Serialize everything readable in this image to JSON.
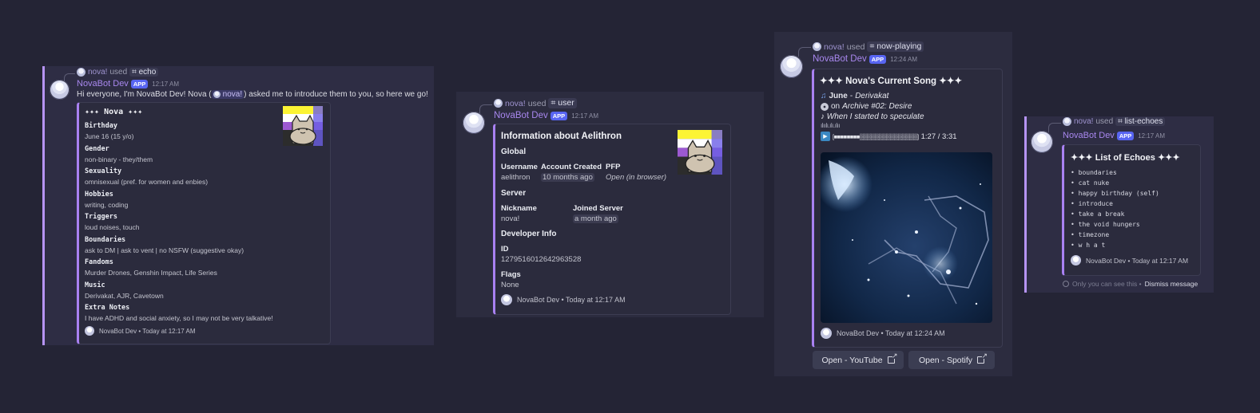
{
  "common": {
    "bot_name": "NovaBot Dev",
    "app_badge": "APP",
    "user_name": "nova!",
    "used_text": "used"
  },
  "echo": {
    "command": "⌗ echo",
    "time": "12:17 AM",
    "message_pre": "Hi everyone, I'm NovaBot Dev! Nova (",
    "mention": "nova!",
    "message_post": ") asked me to introduce them to you, so here we go!",
    "title": "✦✦✦ Nova ✦✦✦",
    "fields": [
      {
        "name": "Birthday",
        "value": "June 16 (15 y/o)"
      },
      {
        "name": "Gender",
        "value": "non-binary - they/them"
      },
      {
        "name": "Sexuality",
        "value": "omnisexual (pref. for women and enbies)"
      },
      {
        "name": "Hobbies",
        "value": "writing, coding"
      },
      {
        "name": "Triggers",
        "value": "loud noises, touch"
      },
      {
        "name": "Boundaries",
        "value": "ask to DM | ask to vent | no NSFW (suggestive okay)"
      },
      {
        "name": "Fandoms",
        "value": "Murder Drones, Genshin Impact, Life Series"
      },
      {
        "name": "Music",
        "value": "Derivakat, AJR, Cavetown"
      },
      {
        "name": "Extra Notes",
        "value": "I have ADHD and social anxiety, so I may not be very talkative!"
      }
    ],
    "footer": "NovaBot Dev • Today at 12:17 AM"
  },
  "user": {
    "command": "⌗ user",
    "time": "12:17 AM",
    "title": "Information about Aelithron",
    "section_global": "Global",
    "username_label": "Username",
    "username_value": "aelithron",
    "created_label": "Account Created",
    "created_value": "10 months ago",
    "pfp_label": "PFP",
    "pfp_value": "Open (in browser)",
    "section_server": "Server",
    "nickname_label": "Nickname",
    "nickname_value": "nova!",
    "joined_label": "Joined Server",
    "joined_value": "a month ago",
    "section_dev": "Developer Info",
    "id_label": "ID",
    "id_value": "1279516012642963528",
    "flags_label": "Flags",
    "flags_value": "None",
    "footer": "NovaBot Dev • Today at 12:17 AM"
  },
  "nowplaying": {
    "command": "⌗ now-playing",
    "time": "12:24 AM",
    "title": "✦✦✦ Nova's Current Song ✦✦✦",
    "song": "June",
    "artist": "Derivakat",
    "album_prefix": "on",
    "album": "Archive #02: Desire",
    "lyric": "♪ When I started to speculate",
    "waveform": "ılıılı.ılı.ılıı",
    "progress_bar": "[■■■■■■■■▒▒▒▒▒▒▒▒▒▒▒▒▒▒▒]",
    "progress": 0.34,
    "position": "1:27",
    "duration": "3:31",
    "time_display": "1:27 / 3:31",
    "footer": "NovaBot Dev • Today at 12:24 AM",
    "buttons": [
      "Open - YouTube",
      "Open - Spotify"
    ]
  },
  "echoes": {
    "command": "⌗ list-echoes",
    "time": "12:17 AM",
    "title": "✦✦✦ List of Echoes ✦✦✦",
    "items": [
      "boundaries",
      "cat nuke",
      "happy birthday (self)",
      "introduce",
      "take a break",
      "the void hungers",
      "timezone",
      "w h a t"
    ],
    "footer": "NovaBot Dev • Today at 12:17 AM",
    "ephemeral_note": "Only you can see this •",
    "dismiss": "Dismiss message"
  },
  "colors": {
    "accent": "#a981f2",
    "name": "#a887ee",
    "background": "#242435",
    "app_badge": "#5865f2"
  }
}
